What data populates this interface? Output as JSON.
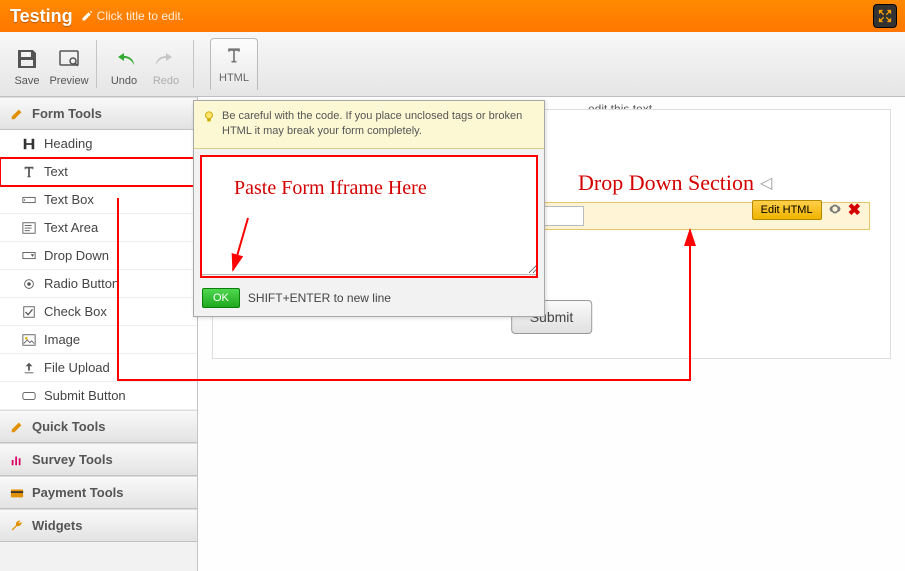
{
  "header": {
    "title": "Testing",
    "edit_hint": "Click title to edit."
  },
  "toolbar": {
    "save": "Save",
    "preview": "Preview",
    "undo": "Undo",
    "redo": "Redo",
    "html": "HTML"
  },
  "sidebar": {
    "sections": {
      "form_tools": "Form Tools",
      "quick_tools": "Quick Tools",
      "survey_tools": "Survey Tools",
      "payment_tools": "Payment Tools",
      "widgets": "Widgets"
    },
    "form_items": [
      "Heading",
      "Text",
      "Text Box",
      "Text Area",
      "Drop Down",
      "Radio Button",
      "Check Box",
      "Image",
      "File Upload",
      "Submit Button"
    ]
  },
  "popup": {
    "warn": "Be careful with the code. If you place unclosed tags or broken HTML it may break your form completely.",
    "ok": "OK",
    "hint": "SHIFT+ENTER to new line"
  },
  "canvas": {
    "placeholder_hint": "edit this text...",
    "edit_html": "Edit HTML",
    "submit": "Submit"
  },
  "annotations": {
    "paste": "Paste Form Iframe Here",
    "dropdown": "Drop Down Section"
  }
}
